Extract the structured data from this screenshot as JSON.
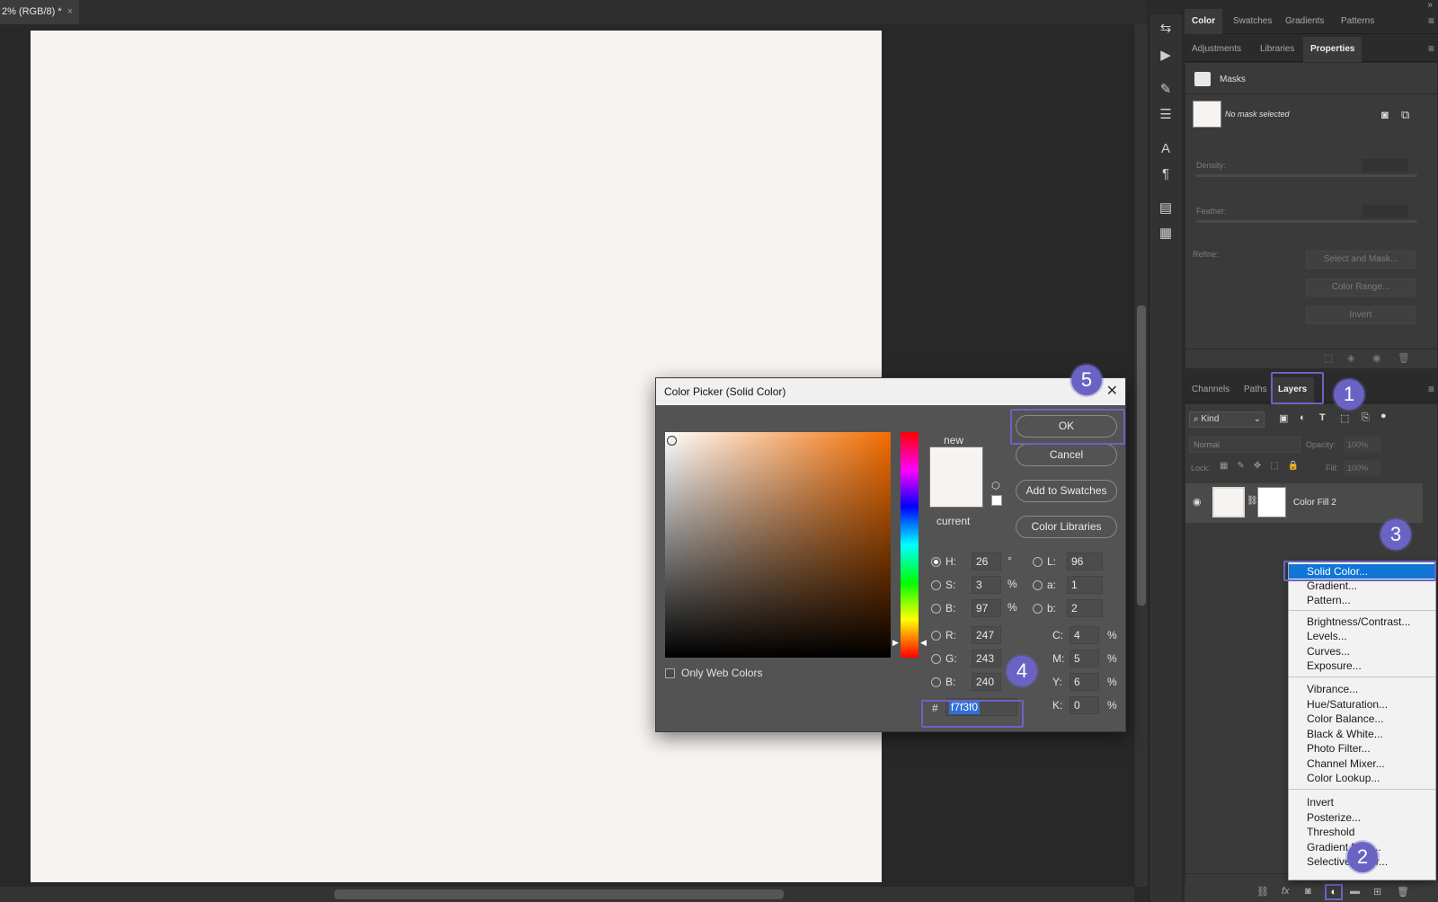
{
  "document": {
    "tab_title": "2% (RGB/8) *",
    "close": "×"
  },
  "toolbar_icons": [
    "history-icon",
    "play-icon",
    "brush-settings-icon",
    "adjust-sliders-icon",
    "character-icon",
    "paragraph-icon",
    "glyphs-icon",
    "notes-icon"
  ],
  "color_panel_tabs": [
    "Color",
    "Swatches",
    "Gradients",
    "Patterns"
  ],
  "adjust_panel_tabs": [
    "Adjustments",
    "Libraries",
    "Properties"
  ],
  "properties": {
    "masks_label": "Masks",
    "no_mask": "No mask selected",
    "density_label": "Density:",
    "feather_label": "Feather:",
    "refine_label": "Refine:",
    "select_and_mask": "Select and Mask...",
    "color_range": "Color Range...",
    "invert": "Invert"
  },
  "layers_panel_tabs": [
    "Channels",
    "Paths",
    "Layers"
  ],
  "layers": {
    "kind": "Kind",
    "blend_mode": "Normal",
    "opacity_label": "Opacity:",
    "opacity_value": "100%",
    "lock_label": "Lock:",
    "fill_label": "Fill:",
    "fill_value": "100%",
    "layer_name": "Color Fill 2"
  },
  "dialog": {
    "title": "Color Picker (Solid Color)",
    "close": "✕",
    "new_label": "new",
    "current_label": "current",
    "ok": "OK",
    "cancel": "Cancel",
    "add_to_swatches": "Add to Swatches",
    "color_libraries": "Color Libraries",
    "only_web_colors": "Only Web Colors",
    "h_label": "H:",
    "h": "26",
    "h_unit": "°",
    "s_label": "S:",
    "s": "3",
    "s_unit": "%",
    "bb_label": "B:",
    "bb": "97",
    "bb_unit": "%",
    "r_label": "R:",
    "r": "247",
    "g_label": "G:",
    "g": "243",
    "b_label": "B:",
    "b": "240",
    "l_label": "L:",
    "l": "96",
    "a_label": "a:",
    "a": "1",
    "lab_b_label": "b:",
    "lab_b": "2",
    "c_label": "C:",
    "c": "4",
    "c_unit": "%",
    "m_label": "M:",
    "m": "5",
    "m_unit": "%",
    "y_label": "Y:",
    "y": "6",
    "y_unit": "%",
    "k_label": "K:",
    "k": "0",
    "k_unit": "%",
    "hash": "#",
    "hex": "f7f3f0",
    "color_hex": "#f7f3f0"
  },
  "adjustment_menu": {
    "group1": [
      "Solid Color...",
      "Gradient...",
      "Pattern..."
    ],
    "group2": [
      "Brightness/Contrast...",
      "Levels...",
      "Curves...",
      "Exposure..."
    ],
    "group3": [
      "Vibrance...",
      "Hue/Saturation...",
      "Color Balance...",
      "Black & White...",
      "Photo Filter...",
      "Channel Mixer...",
      "Color Lookup..."
    ],
    "group4": [
      "Invert",
      "Posterize...",
      "Threshold",
      "Gradient Map...",
      "Selective Color..."
    ]
  },
  "badges": [
    "1",
    "2",
    "3",
    "4",
    "5"
  ],
  "accent_color": "#6b63c4",
  "selection_color": "#0f76d6"
}
